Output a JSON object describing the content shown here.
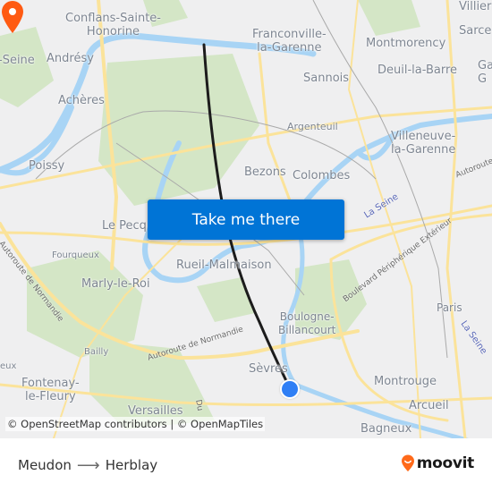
{
  "map": {
    "places": [
      {
        "name": "Conflans-Sainte-\nHonorine",
        "id": "conflans-sainte-honorine"
      },
      {
        "name": "Andrésy",
        "id": "andresy"
      },
      {
        "name": "-Seine",
        "id": "seine-partial"
      },
      {
        "name": "Achères",
        "id": "acheres"
      },
      {
        "name": "Poissy",
        "id": "poissy"
      },
      {
        "name": "Franconville-\nla-Garenne",
        "id": "franconville"
      },
      {
        "name": "Montmorency",
        "id": "montmorency"
      },
      {
        "name": "Villier",
        "id": "villiers-partial"
      },
      {
        "name": "Sarce",
        "id": "sarcelles-partial"
      },
      {
        "name": "Deuil-la-Barre",
        "id": "deuil-la-barre"
      },
      {
        "name": "Ga\nG",
        "id": "garges-partial"
      },
      {
        "name": "Sannois",
        "id": "sannois"
      },
      {
        "name": "Argenteuil",
        "id": "argenteuil"
      },
      {
        "name": "Villeneuve-\nla-Garenne",
        "id": "villeneuve-la-garenne"
      },
      {
        "name": "Bezons",
        "id": "bezons"
      },
      {
        "name": "Colombes",
        "id": "colombes"
      },
      {
        "name": "Le Pecq",
        "id": "le-pecq"
      },
      {
        "name": "Fourqueux",
        "id": "fourqueux"
      },
      {
        "name": "Rueil-Malmaison",
        "id": "rueil-malmaison"
      },
      {
        "name": "Marly-le-Roi",
        "id": "marly-le-roi"
      },
      {
        "name": "Boulogne-\nBillancourt",
        "id": "boulogne-billancourt"
      },
      {
        "name": "Paris",
        "id": "paris"
      },
      {
        "name": "Bailly",
        "id": "bailly"
      },
      {
        "name": "Sèvres",
        "id": "sevres"
      },
      {
        "name": "eux",
        "id": "eux-partial"
      },
      {
        "name": "Fontenay-\nle-Fleury",
        "id": "fontenay-le-fleury"
      },
      {
        "name": "Montrouge",
        "id": "montrouge"
      },
      {
        "name": "Arcueil",
        "id": "arcueil"
      },
      {
        "name": "Versailles",
        "id": "versailles"
      },
      {
        "name": "Bagneux",
        "id": "bagneux"
      }
    ],
    "water_labels": [
      "La Seine",
      "La Seine"
    ],
    "road_labels": [
      "Autoroute de Normandie",
      "Autoroute de Normandie",
      "Boulevard Périphérique Extérieur",
      "Autoroute",
      "Du"
    ],
    "cta_label": "Take me there",
    "attribution": "© OpenStreetMap contributors | © OpenMapTiles",
    "colors": {
      "route_line": "#1c1c1c",
      "destination_marker": "#ff5a12",
      "origin_marker": "#2f7ff5",
      "cta_background": "#0074d6",
      "water": "#a8d4f5",
      "park": "#cfe3c0",
      "road": "#fbe39a"
    }
  },
  "footer": {
    "origin": "Meudon",
    "arrow": "⟶",
    "destination": "Herblay",
    "brand": "moovit",
    "brand_color": "#ff6a1a"
  }
}
